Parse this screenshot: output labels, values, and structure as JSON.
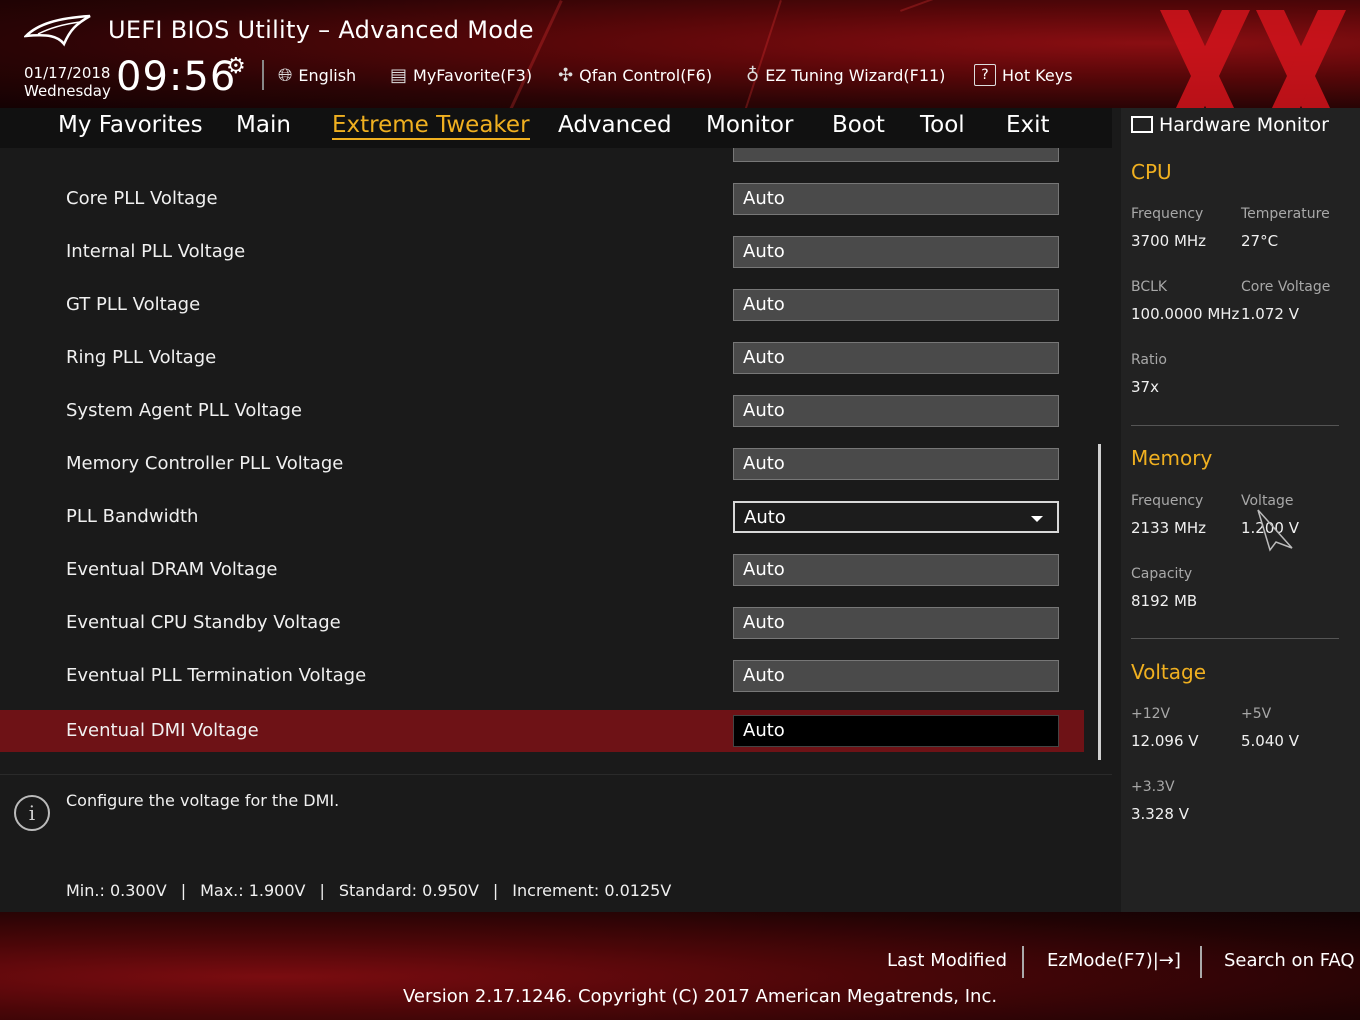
{
  "header": {
    "title": "UEFI BIOS Utility – Advanced Mode",
    "date": "01/17/2018",
    "day": "Wednesday",
    "time": "09:56",
    "language": "English",
    "myfavorite": "MyFavorite(F3)",
    "qfan": "Qfan Control(F6)",
    "ez_tuning": "EZ Tuning Wizard(F11)",
    "hotkeys": "Hot Keys",
    "hotkeys_glyph": "?"
  },
  "nav": {
    "tabs": [
      "My Favorites",
      "Main",
      "Extreme Tweaker",
      "Advanced",
      "Monitor",
      "Boot",
      "Tool",
      "Exit"
    ],
    "active": "Extreme Tweaker"
  },
  "settings": [
    {
      "label": "Core PLL Voltage",
      "value": "Auto"
    },
    {
      "label": "Internal PLL Voltage",
      "value": "Auto"
    },
    {
      "label": "GT PLL Voltage",
      "value": "Auto"
    },
    {
      "label": "Ring PLL Voltage",
      "value": "Auto"
    },
    {
      "label": "System Agent PLL Voltage",
      "value": "Auto"
    },
    {
      "label": "Memory Controller PLL Voltage",
      "value": "Auto"
    },
    {
      "label": "PLL Bandwidth",
      "value": "Auto"
    },
    {
      "label": "Eventual DRAM Voltage",
      "value": "Auto"
    },
    {
      "label": "Eventual CPU Standby Voltage",
      "value": "Auto"
    },
    {
      "label": "Eventual PLL Termination Voltage",
      "value": "Auto"
    },
    {
      "label": "Eventual DMI Voltage",
      "value": "Auto"
    }
  ],
  "info": {
    "description": "Configure the voltage for the DMI.",
    "min": "Min.: 0.300V",
    "max": "Max.: 1.900V",
    "standard": "Standard: 0.950V",
    "increment": "Increment: 0.0125V",
    "separator": "|",
    "icon": "i"
  },
  "hw_monitor": {
    "title": "Hardware Monitor",
    "cpu": {
      "heading": "CPU",
      "frequency_label": "Frequency",
      "frequency": "3700 MHz",
      "temperature_label": "Temperature",
      "temperature": "27°C",
      "bclk_label": "BCLK",
      "bclk": "100.0000 MHz",
      "core_voltage_label": "Core Voltage",
      "core_voltage": "1.072 V",
      "ratio_label": "Ratio",
      "ratio": "37x"
    },
    "memory": {
      "heading": "Memory",
      "frequency_label": "Frequency",
      "frequency": "2133 MHz",
      "voltage_label": "Voltage",
      "voltage": "1.200 V",
      "capacity_label": "Capacity",
      "capacity": "8192 MB"
    },
    "voltage": {
      "heading": "Voltage",
      "v12_label": "+12V",
      "v12": "12.096 V",
      "v5_label": "+5V",
      "v5": "5.040 V",
      "v33_label": "+3.3V",
      "v33": "3.328 V"
    }
  },
  "footer": {
    "last_modified": "Last Modified",
    "ezmode": "EzMode(F7)|→]",
    "search_faq": "Search on FAQ",
    "version": "Version 2.17.1246. Copyright (C) 2017 American Megatrends, Inc."
  },
  "colors": {
    "accent": "#f0b020",
    "selected_row": "#6e1216",
    "header_red": "#8a0e12"
  }
}
